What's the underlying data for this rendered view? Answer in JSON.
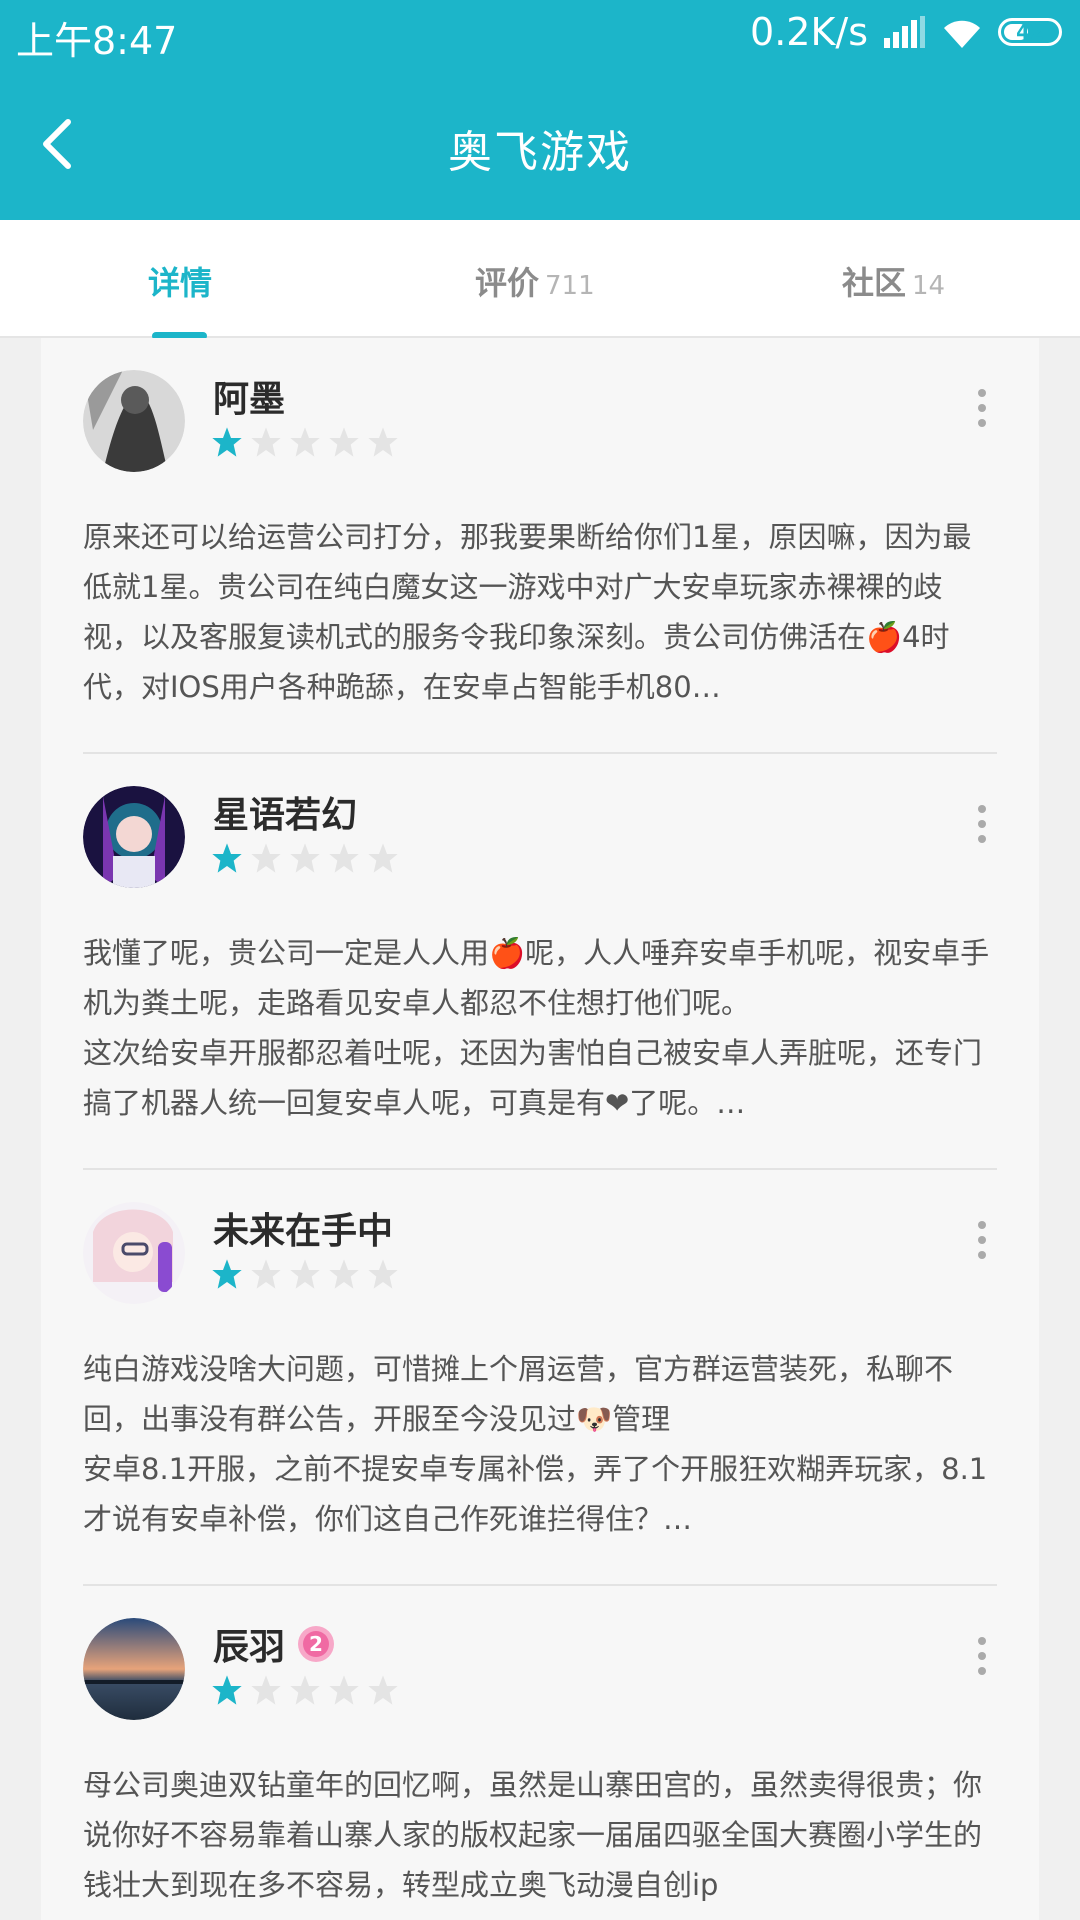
{
  "status_bar": {
    "time": "上午8:47",
    "net_speed": "0.2K/s",
    "battery": "42"
  },
  "app_bar": {
    "title": "奥飞游戏"
  },
  "tabs": [
    {
      "label": "详情",
      "count": "",
      "active": true
    },
    {
      "label": "评价",
      "count": "711",
      "active": false
    },
    {
      "label": "社区",
      "count": "14",
      "active": false
    }
  ],
  "reviews": [
    {
      "username": "阿墨",
      "rating": 1,
      "text": "原来还可以给运营公司打分，那我要果断给你们1星，原因嘛，因为最低就1星。贵公司在纯白魔女这一游戏中对广大安卓玩家赤裸裸的歧视，以及客服复读机式的服务令我印象深刻。贵公司仿佛活在🍎4时代，对IOS用户各种跪舔，在安卓占智能手机80…"
    },
    {
      "username": "星语若幻",
      "rating": 1,
      "text": "我懂了呢，贵公司一定是人人用🍎呢，人人唾弃安卓手机呢，视安卓手机为粪土呢，走路看见安卓人都忍不住想打他们呢。\n这次给安卓开服都忍着吐呢，还因为害怕自己被安卓人弄脏呢，还专门搞了机器人统一回复安卓人呢，可真是有❤了呢。…"
    },
    {
      "username": "未来在手中",
      "rating": 1,
      "text": "纯白游戏没啥大问题，可惜摊上个屑运营，官方群运营装死，私聊不回，出事没有群公告，开服至今没见过🐶管理\n安卓8.1开服，之前不提安卓专属补偿，弄了个开服狂欢糊弄玩家，8.1才说有安卓补偿，你们这自己作死谁拦得住？…"
    },
    {
      "username": "辰羽",
      "rating": 1,
      "badge": "2",
      "text": "母公司奥迪双钻童年的回忆啊，虽然是山寨田宫的，虽然卖得很贵；你说你好不容易靠着山寨人家的版权起家一届届四驱全国大赛圈小学生的钱壮大到现在多不容易，转型成立奥飞动漫自创ip"
    }
  ]
}
